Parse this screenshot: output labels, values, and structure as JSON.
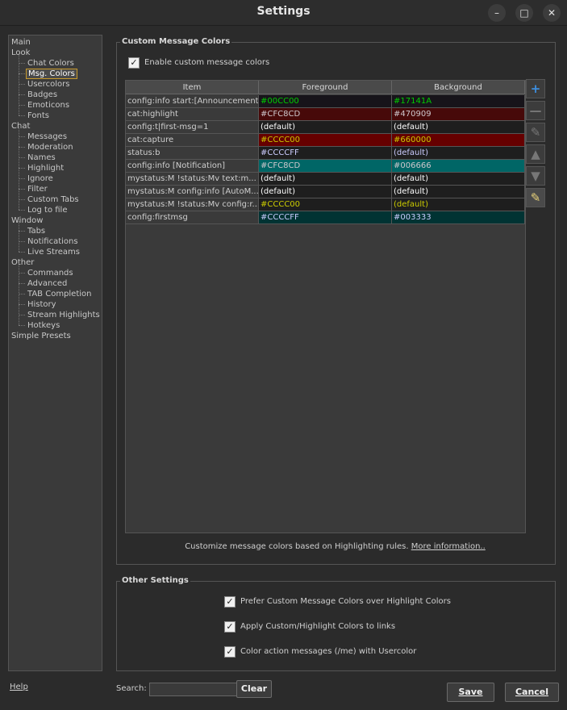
{
  "window": {
    "title": "Settings",
    "minimize_icon": "minimize-icon",
    "maximize_icon": "maximize-icon",
    "close_icon": "close-icon"
  },
  "nav": {
    "selected": "Msg. Colors",
    "items": [
      {
        "label": "Main",
        "level": 0
      },
      {
        "label": "Look",
        "level": 0
      },
      {
        "label": "Chat Colors",
        "level": 1
      },
      {
        "label": "Msg. Colors",
        "level": 1
      },
      {
        "label": "Usercolors",
        "level": 1
      },
      {
        "label": "Badges",
        "level": 1
      },
      {
        "label": "Emoticons",
        "level": 1
      },
      {
        "label": "Fonts",
        "level": 1
      },
      {
        "label": "Chat",
        "level": 0
      },
      {
        "label": "Messages",
        "level": 1
      },
      {
        "label": "Moderation",
        "level": 1
      },
      {
        "label": "Names",
        "level": 1
      },
      {
        "label": "Highlight",
        "level": 1
      },
      {
        "label": "Ignore",
        "level": 1
      },
      {
        "label": "Filter",
        "level": 1
      },
      {
        "label": "Custom Tabs",
        "level": 1
      },
      {
        "label": "Log to file",
        "level": 1
      },
      {
        "label": "Window",
        "level": 0
      },
      {
        "label": "Tabs",
        "level": 1
      },
      {
        "label": "Notifications",
        "level": 1
      },
      {
        "label": "Live Streams",
        "level": 1
      },
      {
        "label": "Other",
        "level": 0
      },
      {
        "label": "Commands",
        "level": 1
      },
      {
        "label": "Advanced",
        "level": 1
      },
      {
        "label": "TAB Completion",
        "level": 1
      },
      {
        "label": "History",
        "level": 1
      },
      {
        "label": "Stream Highlights",
        "level": 1
      },
      {
        "label": "Hotkeys",
        "level": 1
      },
      {
        "label": "Simple Presets",
        "level": 0
      }
    ]
  },
  "custom_colors": {
    "group_title": "Custom Message Colors",
    "enable_label": "Enable custom message colors",
    "enable_checked": true,
    "columns": [
      "Item",
      "Foreground",
      "Background"
    ],
    "rows": [
      {
        "item": "config:info start:[Announcement]",
        "fg": "#00CC00",
        "bg": "#17141A",
        "fg_color": "#00CC00",
        "bg_color": "#17141A"
      },
      {
        "item": "cat:highlight",
        "fg": "#CFC8CD",
        "bg": "#470909",
        "fg_color": "#CFC8CD",
        "bg_color": "#470909"
      },
      {
        "item": "config:t|first-msg=1",
        "fg": "(default)",
        "bg": "(default)",
        "fg_color": "#FFFFFF",
        "bg_color": "#1E1E1E"
      },
      {
        "item": "cat:capture",
        "fg": "#CCCC00",
        "bg": "#660000",
        "fg_color": "#CCCC00",
        "bg_color": "#660000"
      },
      {
        "item": "status:b",
        "fg": "#CCCCFF",
        "bg": "(default)",
        "fg_color": "#CCCCFF",
        "bg_color": "#1E1E1E"
      },
      {
        "item": "config:info [Notification]",
        "fg": "#CFC8CD",
        "bg": "#006666",
        "fg_color": "#CFC8CD",
        "bg_color": "#006666"
      },
      {
        "item": "mystatus:M !status:Mv text:m...",
        "fg": "(default)",
        "bg": "(default)",
        "fg_color": "#FFFFFF",
        "bg_color": "#1E1E1E"
      },
      {
        "item": "mystatus:M config:info [AutoM...",
        "fg": "(default)",
        "bg": "(default)",
        "fg_color": "#FFFFFF",
        "bg_color": "#1E1E1E"
      },
      {
        "item": "mystatus:M !status:Mv config:r...",
        "fg": "#CCCC00",
        "bg": "(default)",
        "fg_color": "#CCCC00",
        "bg_color": "#1E1E1E"
      },
      {
        "item": "config:firstmsg",
        "fg": "#CCCCFF",
        "bg": "#003333",
        "fg_color": "#CCCCFF",
        "bg_color": "#003333"
      }
    ],
    "toolbar_icons": [
      "add-icon",
      "remove-icon",
      "edit-icon",
      "move-up-icon",
      "move-down-icon",
      "notes-icon"
    ],
    "info_text": "Customize message colors based on Highlighting rules.",
    "info_link": "More information.."
  },
  "other_settings": {
    "group_title": "Other Settings",
    "options": [
      {
        "label": "Prefer Custom Message Colors over Highlight Colors",
        "checked": true
      },
      {
        "label": "Apply Custom/Highlight Colors to links",
        "checked": true
      },
      {
        "label": "Color action messages (/me) with Usercolor",
        "checked": true
      }
    ]
  },
  "footer": {
    "help": "Help",
    "search_label": "Search:",
    "search_value": "",
    "clear": "Clear",
    "save": "Save",
    "cancel": "Cancel"
  }
}
